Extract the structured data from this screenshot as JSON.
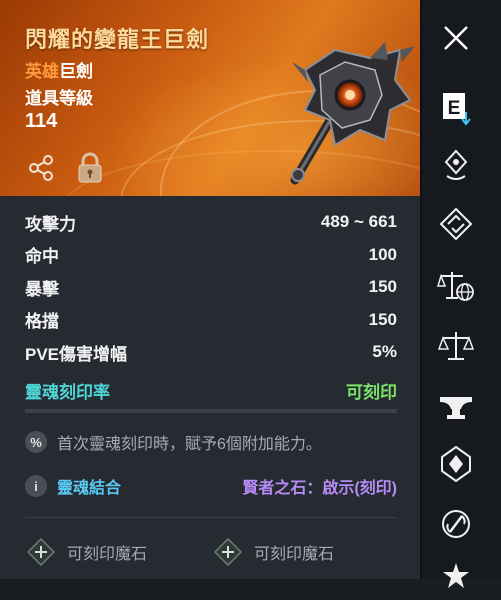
{
  "item": {
    "name": "閃耀的變龍王巨劍",
    "rarity": "英雄",
    "type": "巨劍",
    "item_level_label": "道具等級",
    "item_level": "114"
  },
  "stats": [
    {
      "label": "攻擊力",
      "value": "489 ~ 661"
    },
    {
      "label": "命中",
      "value": "100"
    },
    {
      "label": "暴擊",
      "value": "150"
    },
    {
      "label": "格擋",
      "value": "150"
    },
    {
      "label": "PVE傷害增幅",
      "value": "5%"
    }
  ],
  "soul_engrave": {
    "label": "靈魂刻印率",
    "status": "可刻印",
    "progress": 0.0
  },
  "first_engrave_note": "首次靈魂刻印時，賦予6個附加能力。",
  "soul_bond": {
    "label": "靈魂結合",
    "value": "賢者之石：啟示(刻印)"
  },
  "slots": [
    "可刻印魔石",
    "可刻印魔石"
  ],
  "colors": {
    "title": "#ffd99a",
    "rarity": "#ff9a3c",
    "engrave_label": "#4fd7d7",
    "engrave_status": "#7be36a",
    "bond_label": "#59c8f2",
    "bond_value": "#b68cf5"
  },
  "sidebar_icons": [
    "close-icon",
    "equip-icon",
    "skill-pin-icon",
    "diamond-arrows-icon",
    "compare-globe-icon",
    "balance-icon",
    "anvil-icon",
    "shield-core-icon",
    "ring-link-icon",
    "star-icon"
  ]
}
